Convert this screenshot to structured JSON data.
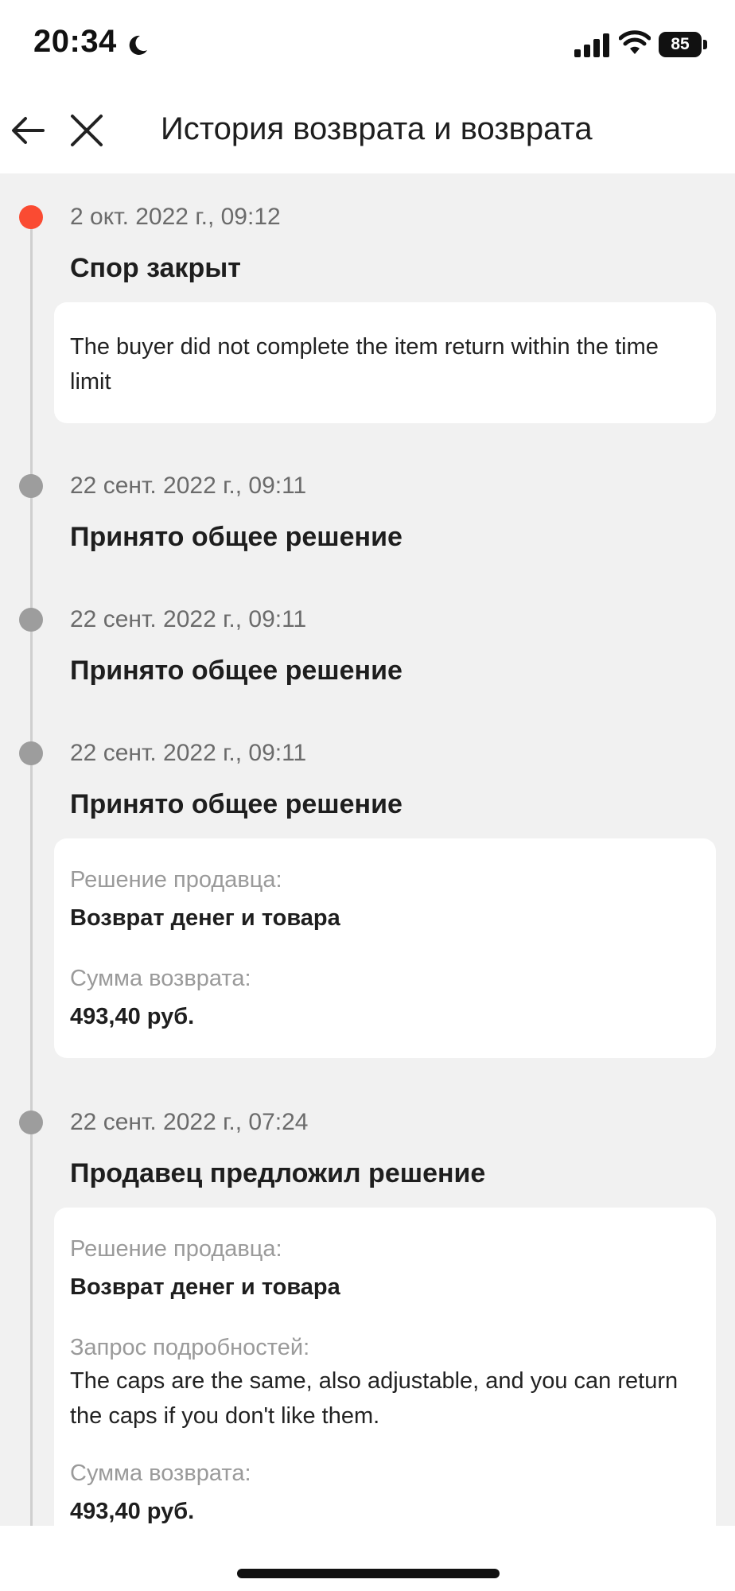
{
  "status_bar": {
    "time": "20:34",
    "battery": "85",
    "icons": [
      "moon-icon",
      "cellular-signal-icon",
      "wifi-icon",
      "battery-icon"
    ]
  },
  "header": {
    "title": "История возврата и возврата",
    "back_icon": "arrow-left-icon",
    "close_icon": "close-icon"
  },
  "colors": {
    "accent": "#fa4b32",
    "inactive_dot": "#9d9d9d",
    "background": "#f1f1f1",
    "card": "#ffffff"
  },
  "events": [
    {
      "date": "2 окт. 2022 г., 09:12",
      "title": "Спор закрыт",
      "note": "The buyer did not complete the item return within the time limit",
      "status": "active"
    },
    {
      "date": "22 сент. 2022 г., 09:11",
      "title": "Принято общее решение"
    },
    {
      "date": "22 сент. 2022 г., 09:11",
      "title": "Принято общее решение"
    },
    {
      "date": "22 сент. 2022 г., 09:11",
      "title": "Принято общее решение",
      "details": {
        "solution_label": "Решение продавца:",
        "solution_value": "Возврат денег и товара",
        "amount_label": "Сумма возврата:",
        "amount_value": "493,40 руб."
      }
    },
    {
      "date": "22 сент. 2022 г., 07:24",
      "title": "Продавец предложил решение",
      "details": {
        "solution_label": "Решение продавца:",
        "solution_value": "Возврат денег и товара",
        "request_label": "Запрос подробностей:",
        "request_value": "The caps are the same, also adjustable, and you can return the caps if you don't like them.",
        "amount_label": "Сумма возврата:",
        "amount_value": "493,40 руб."
      }
    }
  ]
}
